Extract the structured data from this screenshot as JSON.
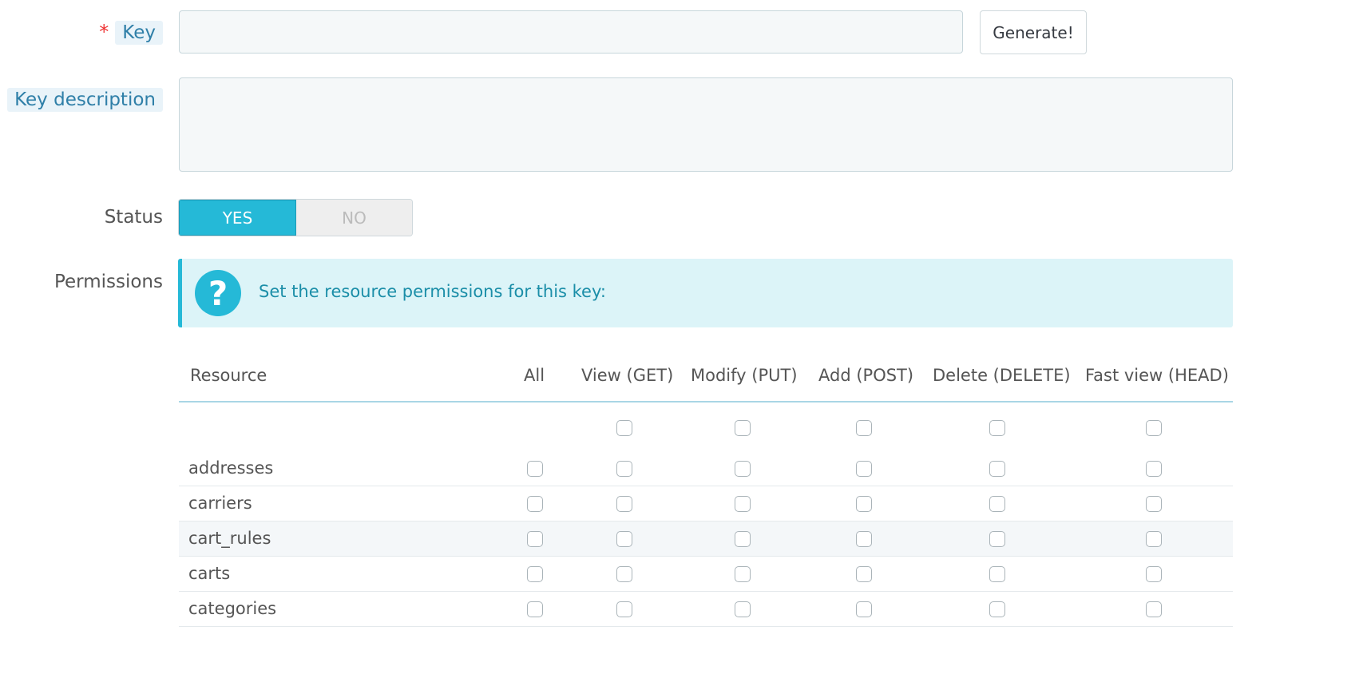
{
  "form": {
    "key_label": "Key",
    "key_required_mark": "*",
    "key_value": "",
    "generate_label": "Generate!",
    "description_label": "Key description",
    "description_value": "",
    "status_label": "Status",
    "status_yes": "YES",
    "status_no": "NO",
    "status_selected": "YES",
    "permissions_label": "Permissions"
  },
  "alert": {
    "icon": "question-icon",
    "message": "Set the resource permissions for this key:"
  },
  "table": {
    "columns": [
      "Resource",
      "All",
      "View (GET)",
      "Modify (PUT)",
      "Add (POST)",
      "Delete (DELETE)",
      "Fast view (HEAD)"
    ],
    "rows": [
      {
        "name": "addresses"
      },
      {
        "name": "carriers"
      },
      {
        "name": "cart_rules"
      },
      {
        "name": "carts"
      },
      {
        "name": "categories"
      }
    ]
  },
  "colors": {
    "accent": "#25b9d7",
    "label_highlight_bg": "#e9f3f9",
    "alert_bg": "#dcf4f8"
  }
}
